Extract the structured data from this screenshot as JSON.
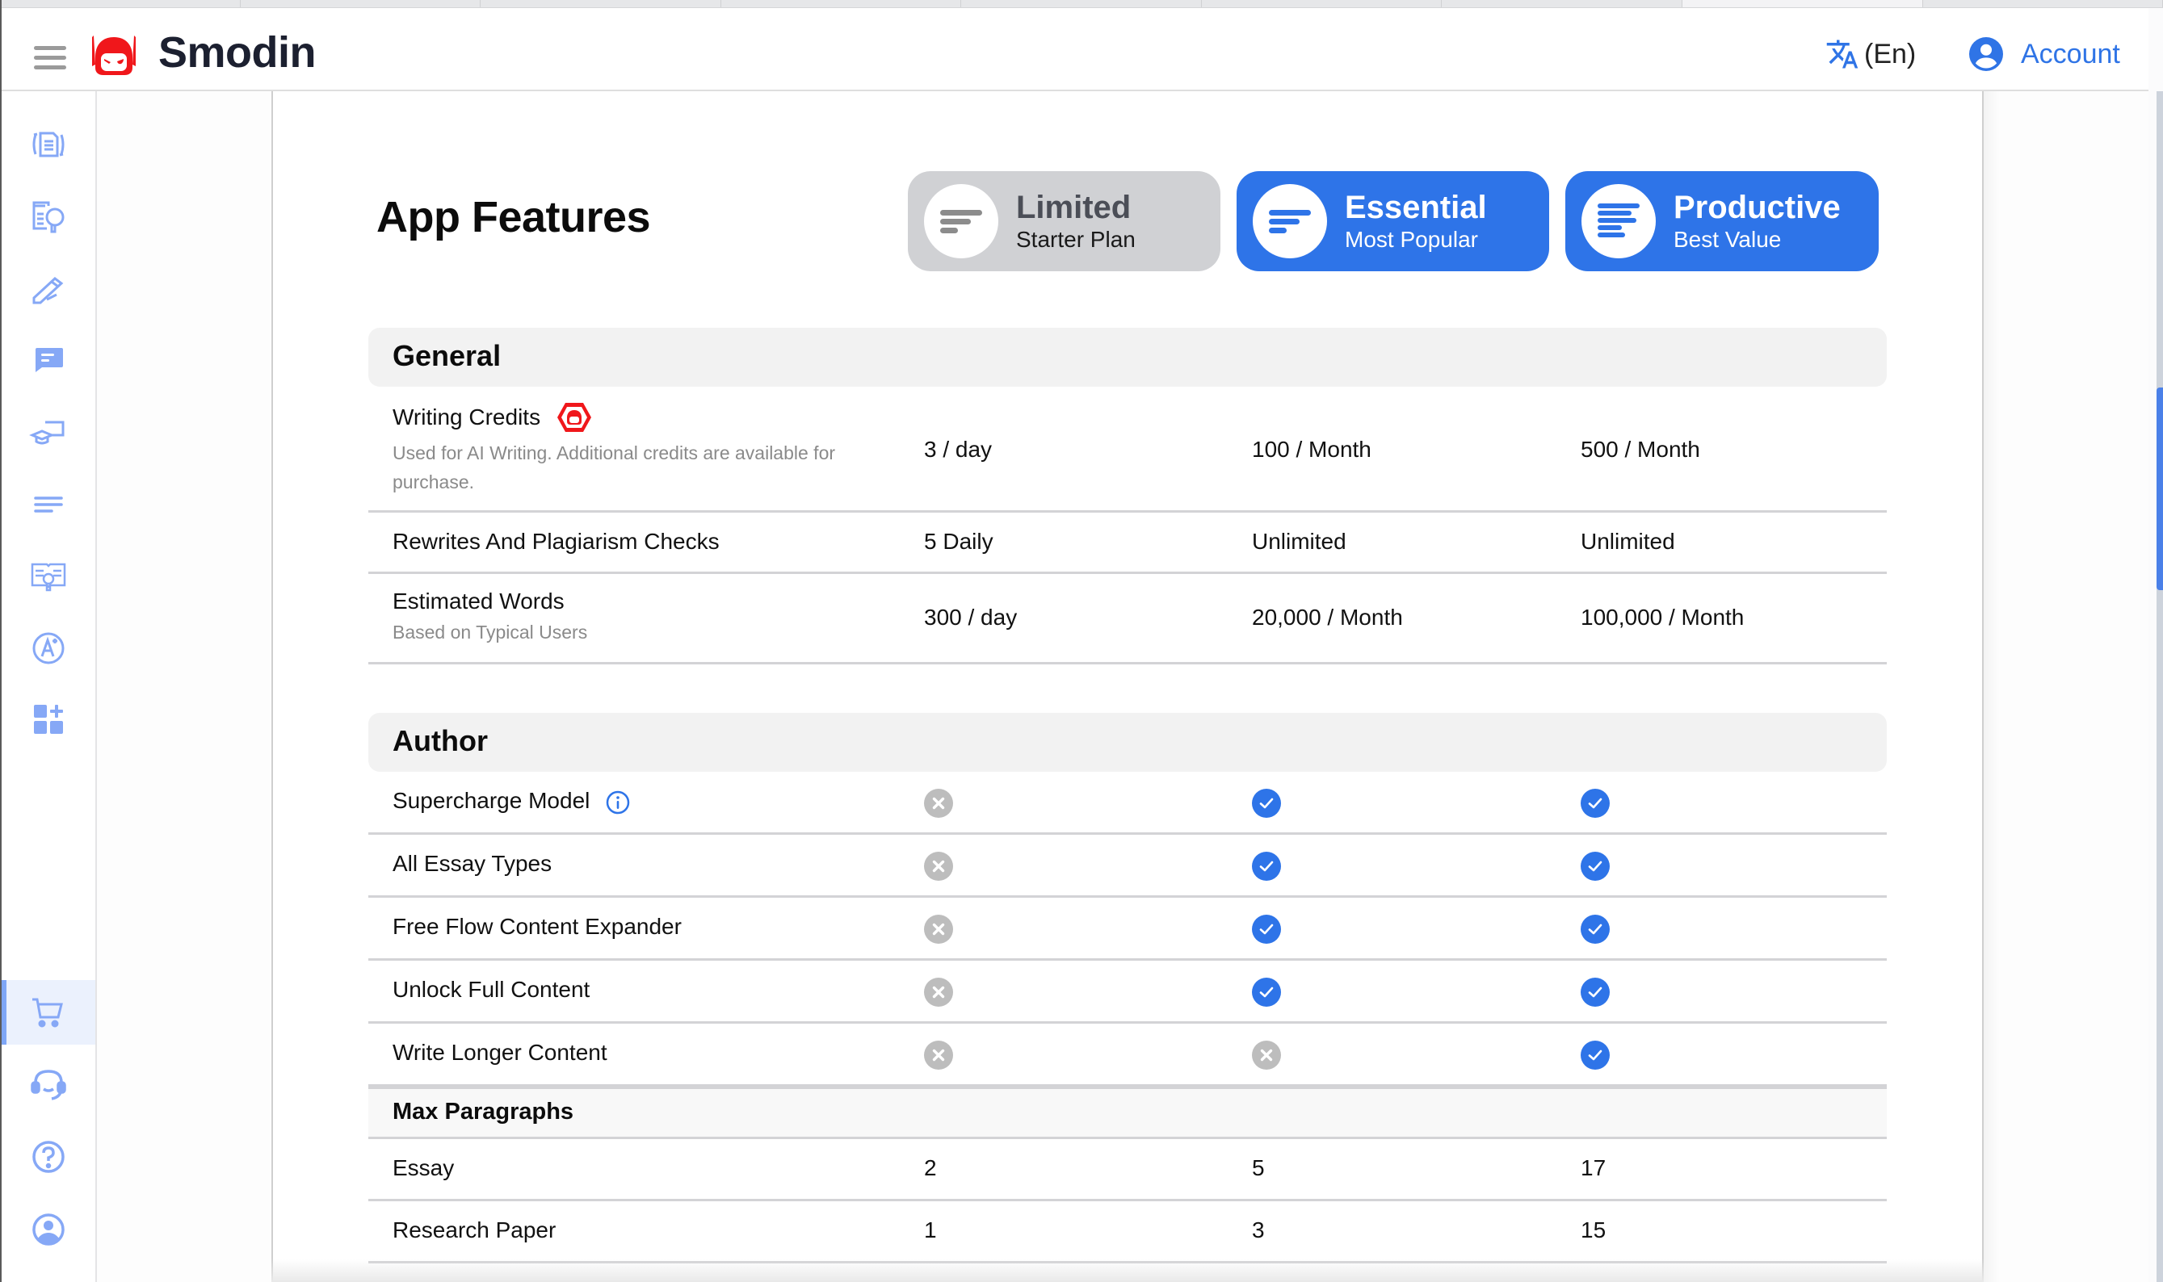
{
  "header": {
    "brand": "Smodin",
    "language_label": "(En)",
    "account_label": "Account"
  },
  "colors": {
    "accent": "#2e74e8",
    "sidebar_icon": "#86a8f6",
    "brand_red": "#f0171b",
    "unavailable": "#bdbdbd"
  },
  "sidebar": {
    "items": [
      {
        "icon": "rewriter-icon"
      },
      {
        "icon": "plagiarism-checker-icon"
      },
      {
        "icon": "author-pen-icon"
      },
      {
        "icon": "chat-icon"
      },
      {
        "icon": "omni-education-icon"
      },
      {
        "icon": "summarizer-icon"
      },
      {
        "icon": "research-icon"
      },
      {
        "icon": "grader-icon"
      },
      {
        "icon": "more-apps-icon"
      }
    ],
    "bottom_items": [
      {
        "icon": "cart-icon",
        "active": true
      },
      {
        "icon": "support-headset-icon"
      },
      {
        "icon": "help-icon"
      },
      {
        "icon": "profile-icon"
      }
    ]
  },
  "page": {
    "title": "App Features"
  },
  "plans": [
    {
      "name": "Limited",
      "subtitle": "Starter Plan",
      "icon": "plan-lines-icon"
    },
    {
      "name": "Essential",
      "subtitle": "Most Popular",
      "icon": "plan-lines-icon"
    },
    {
      "name": "Productive",
      "subtitle": "Best Value",
      "icon": "plan-lines-icon"
    }
  ],
  "sections": {
    "general": {
      "title": "General",
      "rows": [
        {
          "feature": "Writing Credits",
          "description": "Used for AI Writing. Additional credits are available for purchase.",
          "values": [
            "3 / day",
            "100 / Month",
            "500 / Month"
          ]
        },
        {
          "feature": "Rewrites And Plagiarism Checks",
          "values": [
            "5 Daily",
            "Unlimited",
            "Unlimited"
          ]
        },
        {
          "feature": "Estimated Words",
          "description": "Based on Typical Users",
          "values": [
            "300 / day",
            "20,000 / Month",
            "100,000 / Month"
          ]
        }
      ]
    },
    "author": {
      "title": "Author",
      "rows": [
        {
          "feature": "Supercharge Model",
          "has_info": true,
          "included": [
            false,
            true,
            true
          ]
        },
        {
          "feature": "All Essay Types",
          "included": [
            false,
            true,
            true
          ]
        },
        {
          "feature": "Free Flow Content Expander",
          "included": [
            false,
            true,
            true
          ]
        },
        {
          "feature": "Unlock Full Content",
          "included": [
            false,
            true,
            true
          ]
        },
        {
          "feature": "Write Longer Content",
          "included": [
            false,
            false,
            true
          ]
        }
      ],
      "max_paragraphs": {
        "title": "Max Paragraphs",
        "rows": [
          {
            "feature": "Essay",
            "values": [
              "2",
              "5",
              "17"
            ]
          },
          {
            "feature": "Research Paper",
            "values": [
              "1",
              "3",
              "15"
            ]
          }
        ]
      }
    }
  },
  "scroll": {
    "position_fraction": 0.3,
    "visible_fraction": 0.17
  }
}
